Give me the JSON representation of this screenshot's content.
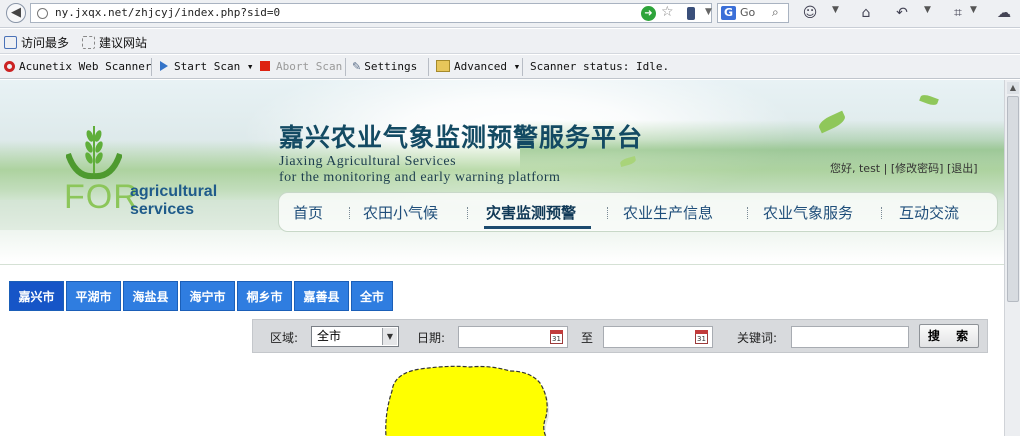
{
  "browser": {
    "url": "ny.jxqx.net/zhjcyj/index.php?sid=0",
    "search_engine": "G",
    "search_placeholder": "Go",
    "bookmarks": [
      "访问最多",
      "建议网站"
    ]
  },
  "scanner_toolbar": {
    "product": "Acunetix Web Scanner",
    "start_scan": "Start Scan",
    "abort_scan": "Abort Scan",
    "settings": "Settings",
    "advanced": "Advanced",
    "status": "Scanner status: Idle."
  },
  "site": {
    "title": "嘉兴农业气象监测预警服务平台",
    "subtitle_line1": "Jiaxing Agricultural Services",
    "subtitle_line2": "for the monitoring and early warning platform",
    "logo_for": "FOR",
    "logo_agricultural": "agricultural",
    "logo_services": "services"
  },
  "user": {
    "greeting": "您好, test",
    "change_password": "[修改密码]",
    "logout": "[退出]"
  },
  "nav": {
    "items": [
      "首页",
      "农田小气候",
      "灾害监测预警",
      "农业生产信息",
      "农业气象服务",
      "互动交流"
    ],
    "active_index": 2
  },
  "city_tabs": {
    "items": [
      "嘉兴市",
      "平湖市",
      "海盐县",
      "海宁市",
      "桐乡市",
      "嘉善县",
      "全市"
    ],
    "active_index": 0
  },
  "filters": {
    "region_label": "区域:",
    "region_value": "全市",
    "date_label": "日期:",
    "to_label": "至",
    "keyword_label": "关键词:",
    "search_button": "搜 索",
    "calendar_day": "31"
  },
  "colors": {
    "tab_blue": "#2f7de0",
    "tab_active": "#1655c7",
    "title_color": "#134a63",
    "map_fill": "#ffff00"
  }
}
